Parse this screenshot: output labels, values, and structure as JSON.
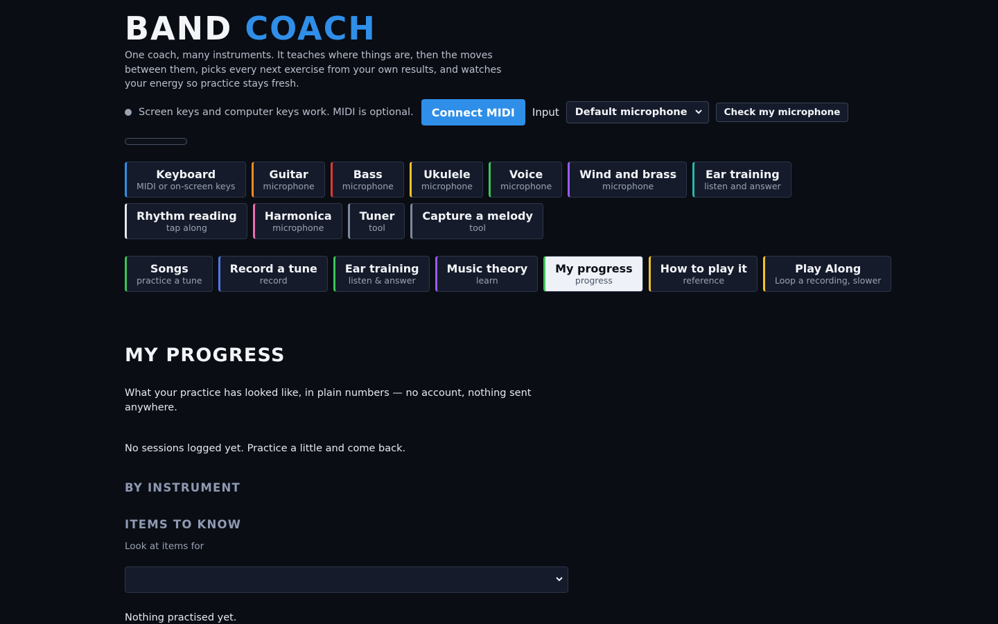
{
  "brand": {
    "part1": "BAND",
    "part2": "COACH"
  },
  "tagline": "One coach, many instruments. It teaches where things are, then the moves between them, picks every next exercise from your own results, and watches your energy so practice stays fresh.",
  "status": {
    "text": "Screen keys and computer keys work. MIDI is optional.",
    "connect_midi_label": "Connect MIDI",
    "input_label": "Input",
    "input_selected": "Default microphone",
    "check_mic_label": "Check my microphone"
  },
  "instruments": [
    {
      "label": "Keyboard",
      "sub": "MIDI or on-screen keys",
      "color": "#2f8fe8"
    },
    {
      "label": "Guitar",
      "sub": "microphone",
      "color": "#f08a24"
    },
    {
      "label": "Bass",
      "sub": "microphone",
      "color": "#e53935"
    },
    {
      "label": "Ukulele",
      "sub": "microphone",
      "color": "#f2c230"
    },
    {
      "label": "Voice",
      "sub": "microphone",
      "color": "#3cc55a"
    },
    {
      "label": "Wind and brass",
      "sub": "microphone",
      "color": "#9a5cf0"
    },
    {
      "label": "Ear training",
      "sub": "listen and answer",
      "color": "#26b8a8"
    },
    {
      "label": "Rhythm reading",
      "sub": "tap along",
      "color": "#e6e9ef"
    },
    {
      "label": "Harmonica",
      "sub": "microphone",
      "color": "#ec6fae"
    },
    {
      "label": "Tuner",
      "sub": "tool",
      "color": "#7d8aa0"
    },
    {
      "label": "Capture a melody",
      "sub": "tool",
      "color": "#7d8aa0"
    }
  ],
  "modes": [
    {
      "label": "Songs",
      "sub": "practice a tune",
      "color": "#3cc55a"
    },
    {
      "label": "Record a tune",
      "sub": "record",
      "color": "#4b7be8"
    },
    {
      "label": "Ear training",
      "sub": "listen & answer",
      "color": "#3cc55a"
    },
    {
      "label": "Music theory",
      "sub": "learn",
      "color": "#9a5cf0"
    },
    {
      "label": "My progress",
      "sub": "progress",
      "color": "#3cc55a"
    },
    {
      "label": "How to play it",
      "sub": "reference",
      "color": "#f2c230"
    },
    {
      "label": "Play Along",
      "sub": "Loop a recording, slower",
      "color": "#f2c230"
    }
  ],
  "active_mode": "My progress",
  "progress": {
    "heading": "MY PROGRESS",
    "intro": "What your practice has looked like, in plain numbers — no account, nothing sent anywhere.",
    "empty": "No sessions logged yet. Practice a little and come back.",
    "by_instrument_heading": "BY INSTRUMENT",
    "items_heading": "ITEMS TO KNOW",
    "look_label": "Look at items for",
    "items_select_value": "",
    "nothing": "Nothing practised yet."
  }
}
